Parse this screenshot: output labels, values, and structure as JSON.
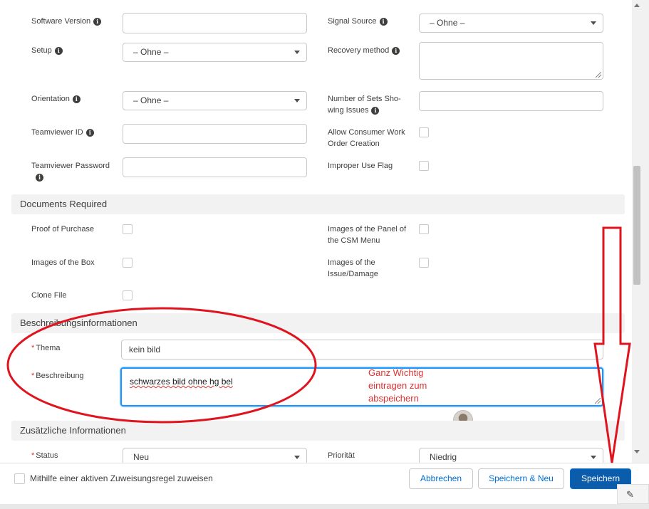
{
  "left_fields": [
    {
      "label": "Software Version",
      "info": true,
      "type": "input",
      "value": ""
    },
    {
      "label": "Setup",
      "info": true,
      "type": "select",
      "value": "– Ohne –"
    },
    {
      "label": "Orientation",
      "info": true,
      "type": "select",
      "value": "– Ohne –"
    },
    {
      "label": "Teamviewer ID",
      "info": true,
      "type": "input",
      "value": ""
    },
    {
      "label": "Teamviewer Password",
      "info": true,
      "type": "input",
      "value": ""
    }
  ],
  "right_fields": [
    {
      "label": "Signal Source",
      "info": true,
      "type": "select",
      "value": "– Ohne –"
    },
    {
      "label": "Recovery method",
      "info": true,
      "type": "textarea",
      "value": ""
    },
    {
      "label_line1": "Number of Sets Sho-",
      "label_line2": "wing Issues",
      "info": true,
      "type": "input",
      "value": ""
    },
    {
      "label_line1": "Allow Consumer Work",
      "label_line2": "Order Creation",
      "type": "checkbox",
      "checked": false
    },
    {
      "label": "Improper Use Flag",
      "type": "checkbox",
      "checked": false
    }
  ],
  "sections": {
    "documents": "Documents Required",
    "description": "Beschreibungsinformationen",
    "additional": "Zusätzliche Informationen"
  },
  "documents": {
    "proof_of_purchase": "Proof of Purchase",
    "images_box": "Images of the Box",
    "clone_file": "Clone File",
    "panel_line1": "Images of the Panel of",
    "panel_line2": "the CSM Menu",
    "issue_line1": "Images of the",
    "issue_line2": "Issue/Damage"
  },
  "description": {
    "subject_label": "Thema",
    "subject_value": "kein bild",
    "desc_label": "Beschreibung",
    "desc_value": "schwarzes bild ohne hg bel"
  },
  "additional": {
    "status_label": "Status",
    "status_value": "Neu",
    "priority_label": "Priorität",
    "priority_value": "Niedrig"
  },
  "annotation": {
    "line1": "Ganz Wichtig",
    "line2": "eintragen zum",
    "line3": "abspeichern",
    "color": "#e03030"
  },
  "footer": {
    "assign_rule_label": "Mithilfe einer aktiven Zuweisungsregel zuweisen",
    "cancel": "Abbrechen",
    "save_new": "Speichern & Neu",
    "save": "Speichern"
  },
  "colors": {
    "brand": "#0b5cab",
    "link": "#0070d2",
    "section_bg": "#f3f2f2",
    "required": "#c23934"
  }
}
